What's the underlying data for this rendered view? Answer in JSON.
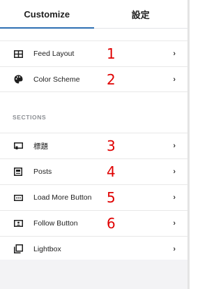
{
  "tabs": [
    {
      "label": "Customize",
      "active": true
    },
    {
      "label": "設定",
      "active": false
    }
  ],
  "top_items": [
    {
      "label": "Feed Layout",
      "icon": "feed-layout-icon",
      "annotation": "1"
    },
    {
      "label": "Color Scheme",
      "icon": "palette-icon",
      "annotation": "2"
    }
  ],
  "sections_heading": "SECTIONS",
  "section_items": [
    {
      "label": "標題",
      "icon": "header-icon",
      "annotation": "3"
    },
    {
      "label": "Posts",
      "icon": "posts-icon",
      "annotation": "4"
    },
    {
      "label": "Load More Button",
      "icon": "load-more-icon",
      "annotation": "5"
    },
    {
      "label": "Follow Button",
      "icon": "follow-button-icon",
      "annotation": "6"
    },
    {
      "label": "Lightbox",
      "icon": "lightbox-icon",
      "annotation": ""
    }
  ],
  "chevron": "›",
  "colors": {
    "accent": "#2e6fb3",
    "annotation": "#e00000"
  }
}
